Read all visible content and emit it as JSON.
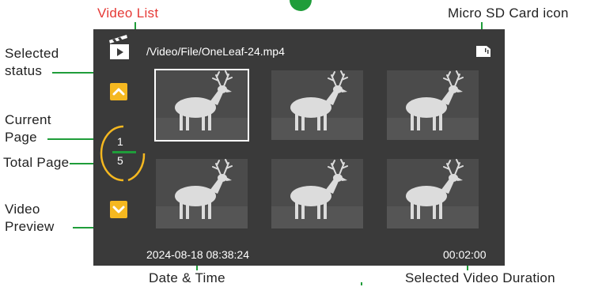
{
  "callouts": {
    "video_list": "Video List",
    "micro_sd": "Micro SD Card icon",
    "selected_line1": "Selected",
    "selected_line2": "status",
    "current_line1": "Current",
    "current_line2": "Page",
    "total_page": "Total Page",
    "video_line1": "Video",
    "video_line2": "Preview",
    "date_time": "Date & Time",
    "duration": "Selected Video Duration"
  },
  "screen": {
    "file_path": "/Video/File/OneLeaf-24.mp4",
    "current_page": "1",
    "total_pages": "5",
    "datetime": "2024-08-18 08:38:24",
    "duration": "00:02:00",
    "selected_index": 0
  },
  "icons": {
    "header": "video-clapper-icon",
    "sd": "sd-card-icon",
    "up": "chevron-up-icon",
    "down": "chevron-down-icon"
  },
  "colors": {
    "screen_bg": "#3a3a3a",
    "accent": "#f5b820",
    "leader": "#1f9d3a",
    "video_list_label": "#e53935"
  }
}
